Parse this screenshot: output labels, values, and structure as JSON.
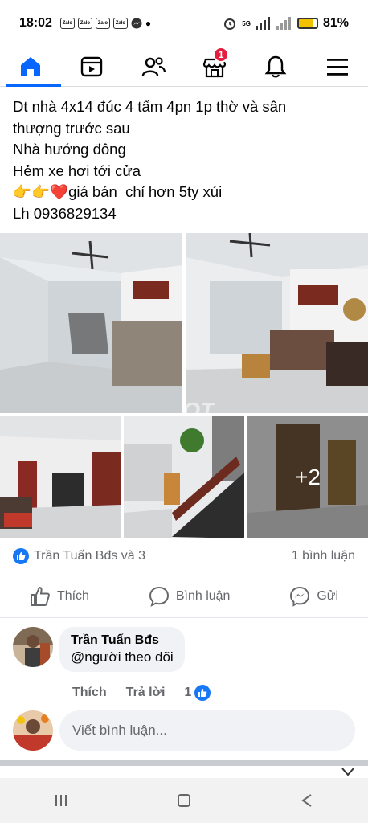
{
  "status_bar": {
    "time": "18:02",
    "zalo_label": "Zalo",
    "network": "5G",
    "battery": "81%"
  },
  "navbar": {
    "items": [
      {
        "name": "home",
        "active": true
      },
      {
        "name": "video"
      },
      {
        "name": "friends"
      },
      {
        "name": "marketplace",
        "badge": "1"
      },
      {
        "name": "notifications"
      },
      {
        "name": "menu"
      }
    ]
  },
  "post": {
    "lines": [
      "Dt nhà 4x14 đúc 4 tấm 4pn 1p thờ và sân",
      "thượng trước sau",
      "Nhà hướng đông",
      "Hẻm xe hơi tới cửa",
      "👉👉❤️giá bán  chỉ hơn 5ty xúi",
      "Lh 0936829134"
    ],
    "photo_more": "+2",
    "watermark": "choTOT"
  },
  "reactions": {
    "names": "Trần Tuấn Bđs và 3",
    "comments": "1 bình luận"
  },
  "actions": {
    "like": "Thích",
    "comment": "Bình luận",
    "send": "Gửi"
  },
  "comment": {
    "author": "Trần Tuấn Bđs",
    "text": "@người theo dõi",
    "like": "Thích",
    "reply": "Trả lời",
    "like_count": "1"
  },
  "write_comment": {
    "placeholder": "Viết bình luận..."
  },
  "colors": {
    "accent": "#0866ff",
    "badge": "#e41e3f",
    "like": "#1877f2"
  }
}
